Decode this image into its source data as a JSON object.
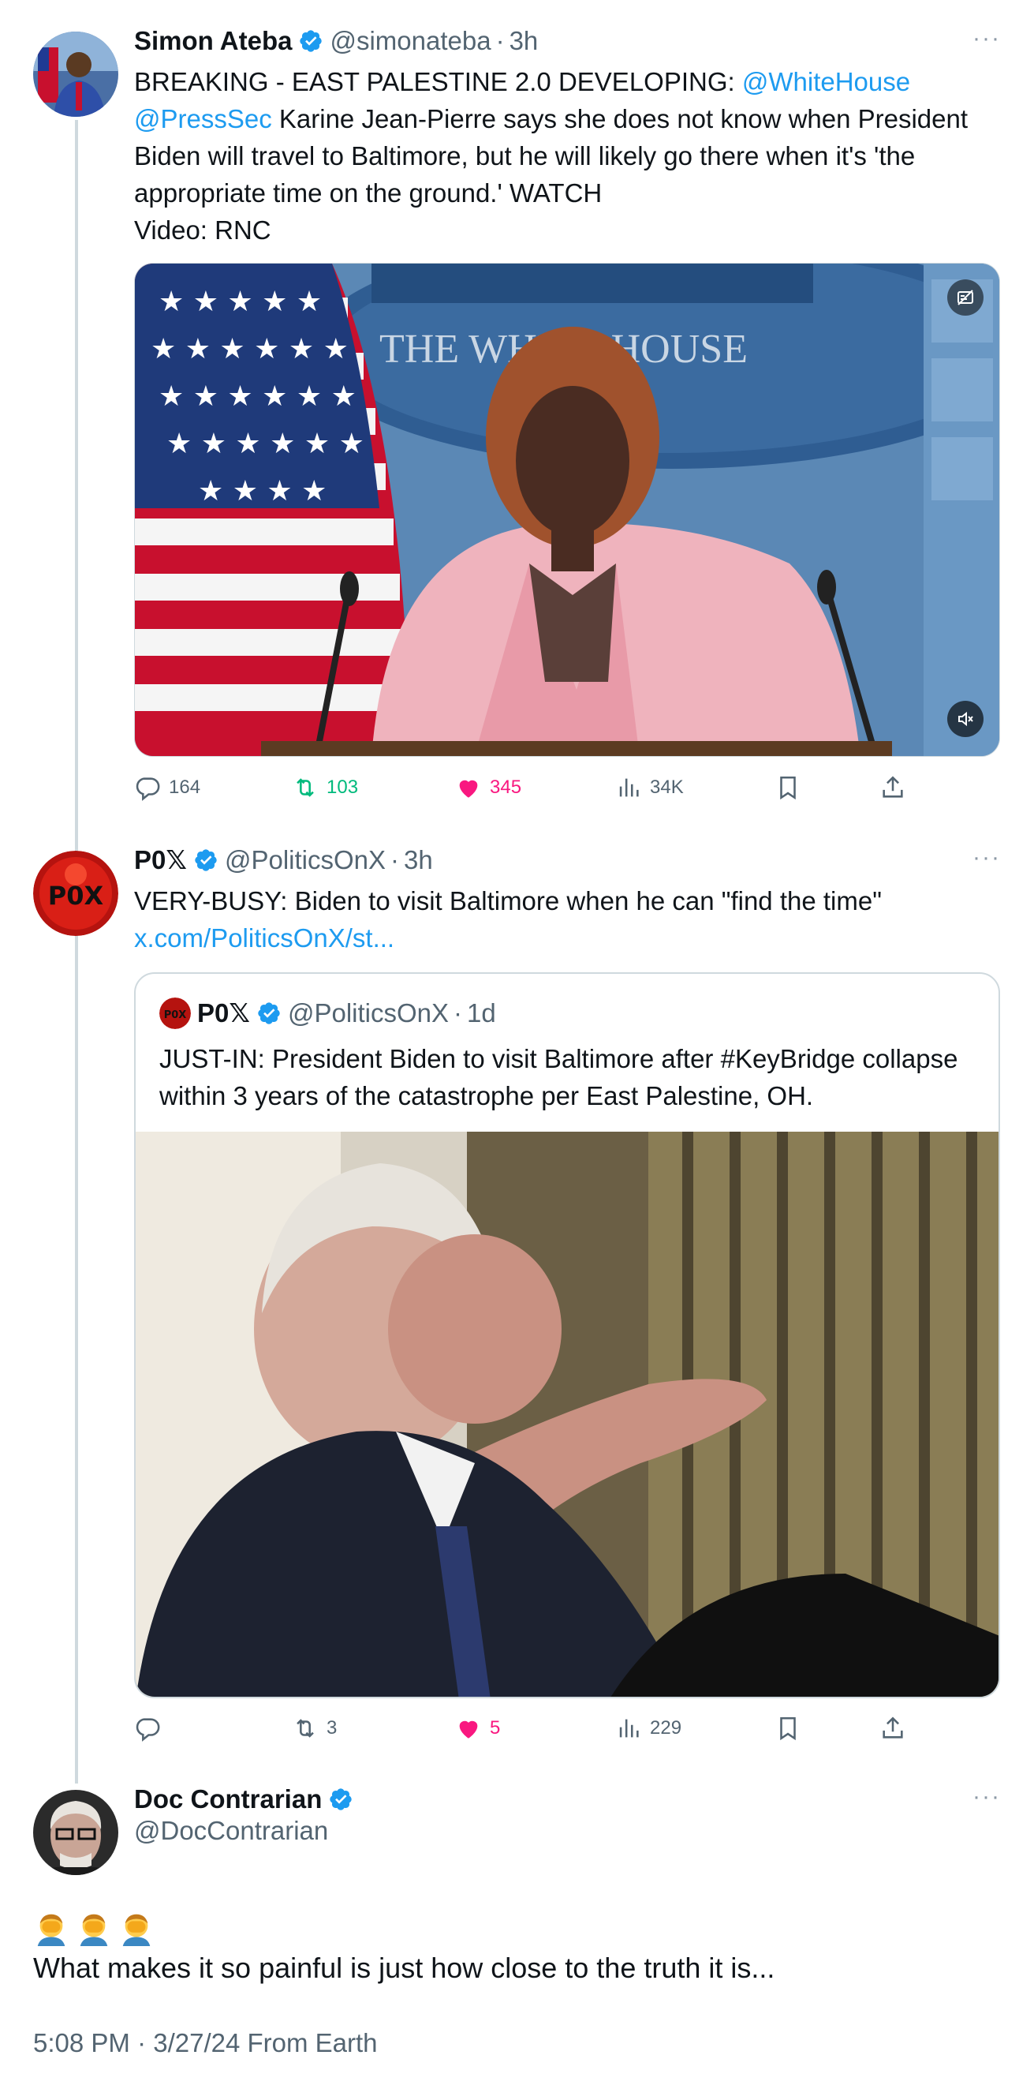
{
  "tweet1": {
    "name": "Simon Ateba",
    "handle": "@simonateba",
    "time": "3h",
    "text_prefix": "BREAKING - EAST PALESTINE 2.0 DEVELOPING: ",
    "mention1": "@WhiteHouse",
    "mention2": "@PressSec",
    "text_rest": " Karine Jean-Pierre says she does not know when President Biden will travel to Baltimore, but he will likely go there when it's 'the appropriate time on the ground.' WATCH",
    "text_line2": "Video: RNC",
    "video_text": "THE WHITE HOUSE",
    "replies": "164",
    "retweets": "103",
    "likes": "345",
    "views": "34K"
  },
  "tweet2": {
    "name": "P0𝕏",
    "handle": "@PoliticsOnX",
    "time": "3h",
    "text": "VERY-BUSY: Biden to visit Baltimore when he can \"find the time\"",
    "link": "x.com/PoliticsOnX/st...",
    "avatar_text": "P0X",
    "replies": "",
    "retweets": "3",
    "likes": "5",
    "views": "229",
    "quote": {
      "name": "P0𝕏",
      "handle": "@PoliticsOnX",
      "time": "1d",
      "text": "JUST-IN: President Biden to visit Baltimore after #KeyBridge collapse within 3 years of the catastrophe per East Palestine, OH."
    }
  },
  "tweet3": {
    "name": "Doc Contrarian",
    "handle": "@DocContrarian",
    "text": "What makes it so painful is just how close to the truth it is...",
    "emoji_count": 3,
    "timestamp": "5:08 PM · 3/27/24 From Earth"
  },
  "colors": {
    "accent": "#1d9bf0",
    "secondary_text": "#536471",
    "retweet_green": "#00ba7c",
    "like_pink": "#f91880",
    "border": "#cfd9de"
  },
  "icons": [
    "verified-badge-icon",
    "more-icon",
    "reply-icon",
    "retweet-icon",
    "like-icon",
    "views-icon",
    "bookmark-icon",
    "share-icon",
    "mute-icon",
    "caption-icon",
    "facepalm-emoji-icon"
  ]
}
